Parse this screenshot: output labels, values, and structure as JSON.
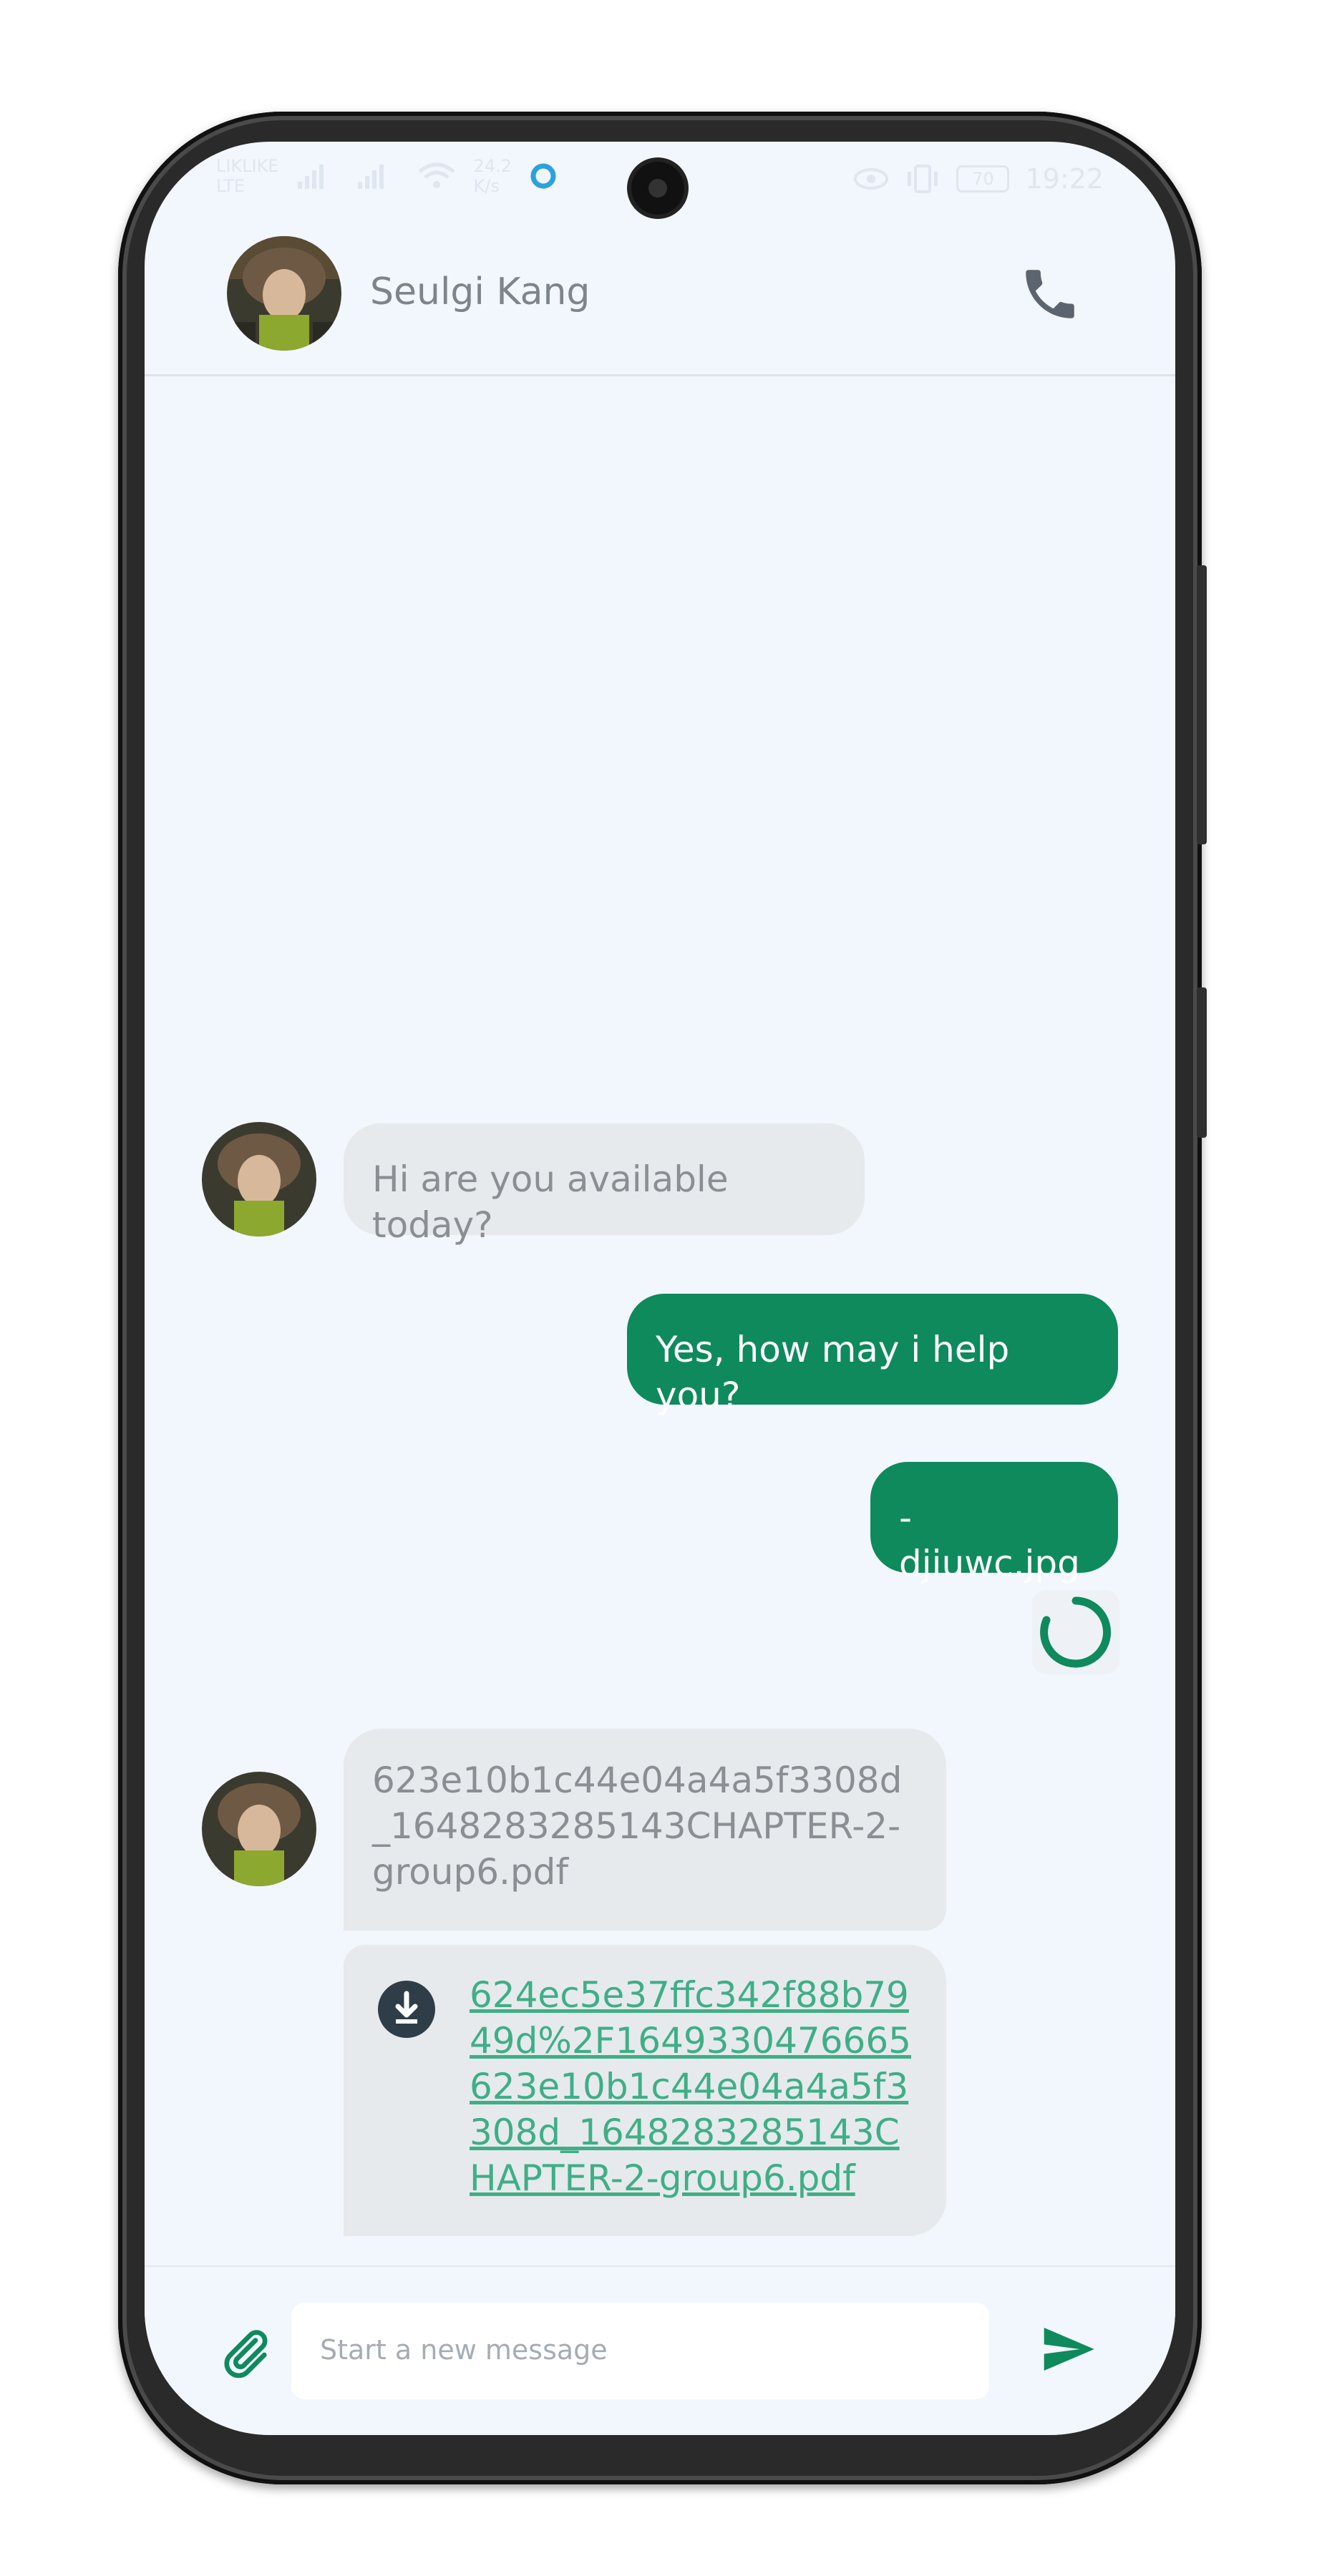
{
  "status_bar": {
    "carrier_line1": "LIKLIKE",
    "carrier_line2": "LTE",
    "speed": "24.2",
    "speed_unit": "K/s",
    "battery": "70",
    "time": "19:22"
  },
  "header": {
    "contact_name": "Seulgi Kang"
  },
  "messages": {
    "m1": "Hi are you available today?",
    "m2": "Yes, how may i help you?",
    "m3": "-djiuwc.jpg",
    "m4": "623e10b1c44e04a4a5f3308d_1648283285143CHAPTER-2-group6.pdf",
    "m5_link": "624ec5e37ffc342f88b7949d%2F1649330476665623e10b1c44e04a4a5f3308d_1648283285143CHAPTER-2-group6.pdf"
  },
  "composer": {
    "placeholder": "Start a new message"
  },
  "colors": {
    "accent": "#0e8a5c",
    "incoming_bubble": "#e6eaec",
    "link": "#3fae86",
    "background": "#f2f6fd"
  },
  "icons": {
    "call": "phone-icon",
    "attach": "paperclip-icon",
    "send": "send-icon",
    "download": "download-icon",
    "loading": "spinner-icon"
  }
}
